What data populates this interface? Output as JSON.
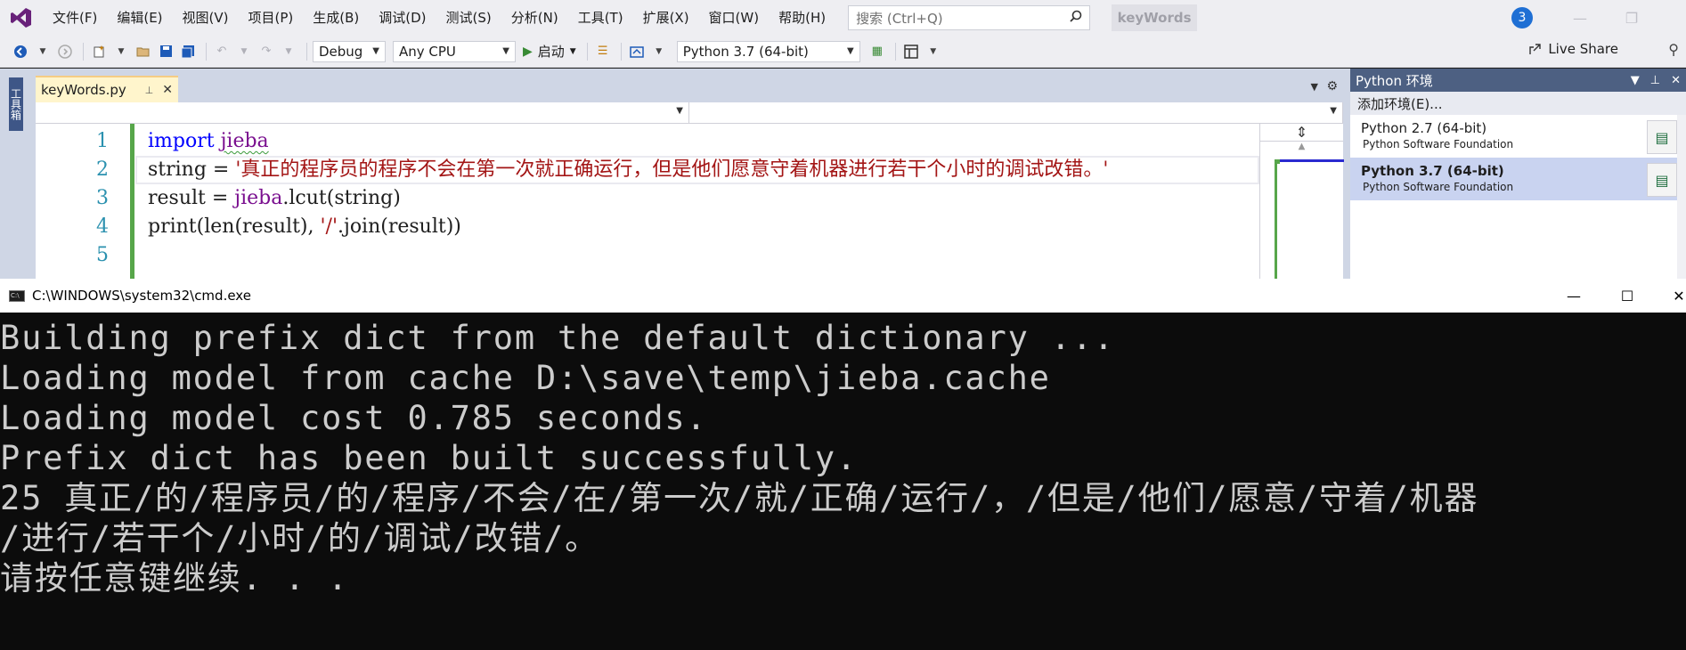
{
  "vs": {
    "logo_icon": "visual-studio-logo-icon",
    "menu": [
      "文件(F)",
      "编辑(E)",
      "视图(V)",
      "项目(P)",
      "生成(B)",
      "调试(D)",
      "测试(S)",
      "分析(N)",
      "工具(T)",
      "扩展(X)",
      "窗口(W)",
      "帮助(H)"
    ],
    "search_placeholder": "搜索 (Ctrl+Q)",
    "solution_name": "keyWords",
    "notification_count": "3",
    "toolbar": {
      "config": "Debug",
      "platform": "Any CPU",
      "start_label": "启动",
      "python_env": "Python 3.7 (64-bit)",
      "live_share": "Live Share"
    },
    "toolbox_label": "工具箱"
  },
  "editor": {
    "tab_name": "keyWords.py",
    "line_numbers": [
      "1",
      "2",
      "3",
      "4",
      "5"
    ],
    "code": {
      "l1_kw": "import",
      "l1_mod": "jieba",
      "l2_var": "string = ",
      "l2_str": "'真正的程序员的程序不会在第一次就正确运行，但是他们愿意守着机器进行若干个小时的调试改错。'",
      "l3_pre": "result = ",
      "l3_id": "jieba",
      "l3_post": ".lcut(string)",
      "l4_pre": "print(len(result), ",
      "l4_str": "'/'",
      "l4_post": ".join(result))"
    }
  },
  "python_env_panel": {
    "title": "Python 环境",
    "add_env": "添加环境(E)...",
    "envs": [
      {
        "name": "Python 2.7 (64-bit)",
        "vendor": "Python Software Foundation",
        "selected": false
      },
      {
        "name": "Python 3.7 (64-bit)",
        "vendor": "Python Software Foundation",
        "selected": true
      }
    ]
  },
  "cmd": {
    "title": "C:\\WINDOWS\\system32\\cmd.exe",
    "output": [
      "Building prefix dict from the default dictionary ...",
      "Loading model from cache D:\\save\\temp\\jieba.cache",
      "Loading model cost 0.785 seconds.",
      "Prefix dict has been built successfully.",
      "25 真正/的/程序员/的/程序/不会/在/第一次/就/正确/运行/，/但是/他们/愿意/守着/机器",
      "/进行/若干个/小时/的/调试/改错/。",
      "请按任意键继续. . ."
    ]
  },
  "colors": {
    "menu_bg": "#eeeef2",
    "panel_header": "#4d6082",
    "keyword": "#0000ff",
    "string": "#a31515",
    "identifier": "#7a0f8f",
    "line_number": "#2b91af",
    "console_bg": "#0c0c0c",
    "console_text": "#cccccc"
  }
}
